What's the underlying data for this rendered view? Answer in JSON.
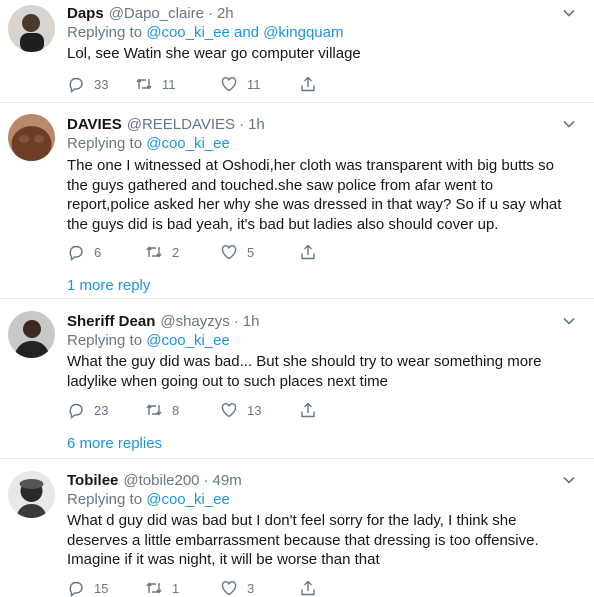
{
  "tweets": [
    {
      "name": "Daps",
      "handle": "@Dapo_claire",
      "time": "2h",
      "replying_prefix": "Replying to",
      "replying_mentions": "@coo_ki_ee and @kingquam",
      "text": "Lol, see Watin she wear go computer village",
      "replies": "33",
      "retweets": "11",
      "likes": "11"
    },
    {
      "name": "DAVIES",
      "handle": "@REELDAVIES",
      "time": "1h",
      "replying_prefix": "Replying to",
      "replying_mentions": "@coo_ki_ee",
      "text": "The one I witnessed at Oshodi,her cloth was transparent with big butts so the guys gathered and touched.she saw police from afar went to report,police asked her why she  was dressed in that way? So if u say what the guys did is bad yeah, it's bad but ladies also should cover up.",
      "replies": "6",
      "retweets": "2",
      "likes": "5",
      "more_replies": "1 more reply"
    },
    {
      "name": "Sheriff Dean",
      "handle": "@shayzys",
      "time": "1h",
      "replying_prefix": "Replying to",
      "replying_mentions": "@coo_ki_ee",
      "text": "What the guy did was bad... But she should try to wear something more ladylike when going out to such places next time",
      "replies": "23",
      "retweets": "8",
      "likes": "13",
      "more_replies": "6 more replies"
    },
    {
      "name": "Tobilee",
      "handle": "@tobile200",
      "time": "49m",
      "replying_prefix": "Replying to",
      "replying_mentions": "@coo_ki_ee",
      "text": "What d guy did was bad but I don't feel sorry for the lady, I think she deserves a little embarrassment because that dressing is too offensive. Imagine if it was night, it will be worse than that",
      "replies": "15",
      "retweets": "1",
      "likes": "3"
    }
  ],
  "dot": "·",
  "colors": {
    "link": "#1b95e0",
    "muted": "#657786",
    "text": "#14171a",
    "divider": "#e6ecf0"
  },
  "icons": [
    "reply-icon",
    "retweet-icon",
    "like-icon",
    "share-icon",
    "caret-down-icon"
  ]
}
